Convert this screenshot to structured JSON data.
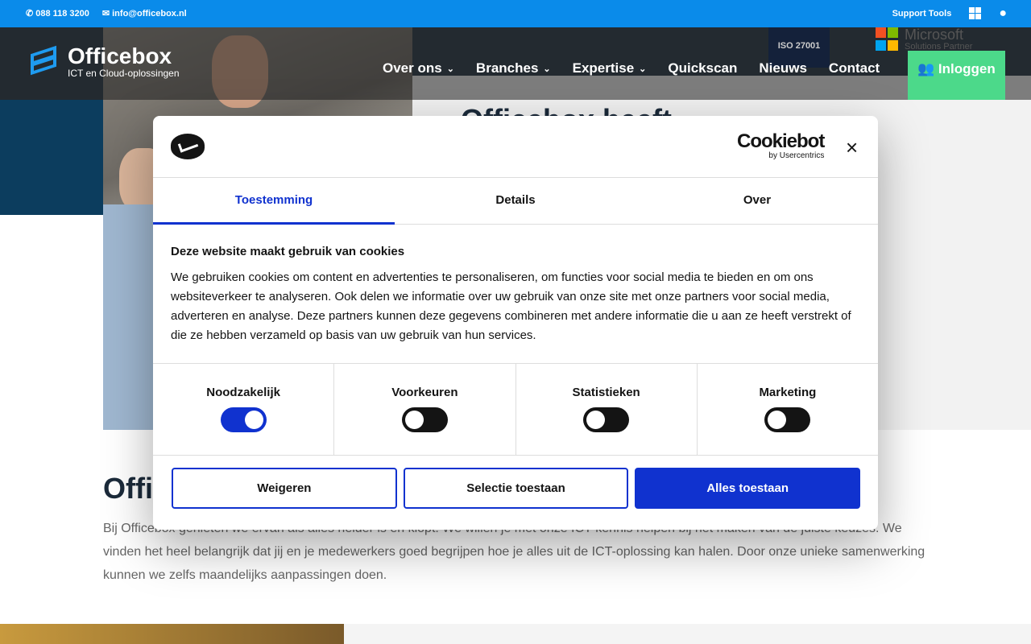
{
  "topbar": {
    "phone": "088 118 3200",
    "email": "info@officebox.nl",
    "support": "Support Tools"
  },
  "header": {
    "logo_name": "Officebox",
    "logo_tagline": "ICT en Cloud-oplossingen",
    "nav": [
      "Over ons",
      "Branches",
      "Expertise",
      "Quickscan",
      "Nieuws",
      "Contact"
    ],
    "login": "Inloggen",
    "iso": "ISO 27001",
    "ms_line1": "Microsoft",
    "ms_line2": "Solutions Partner"
  },
  "hero": {
    "title": "Officebox heeft"
  },
  "section": {
    "title": "Offi",
    "text": "Bij Officebox genieten we ervan als alles helder is en klopt. We willen je met onze ICT-kennis helpen bij het maken van de juiste keuzes. We vinden het heel belangrijk dat jij en je medewerkers goed begrijpen hoe je alles uit de ICT-oplossing kan halen. Door onze unieke samenwerking kunnen we zelfs maandelijks aanpassingen doen."
  },
  "dialog": {
    "brand": "Cookiebot",
    "brand_sub": "by Usercentrics",
    "close": "×",
    "tabs": [
      "Toestemming",
      "Details",
      "Over"
    ],
    "heading": "Deze website maakt gebruik van cookies",
    "body": "We gebruiken cookies om content en advertenties te personaliseren, om functies voor social media te bieden en om ons websiteverkeer te analyseren. Ook delen we informatie over uw gebruik van onze site met onze partners voor social media, adverteren en analyse. Deze partners kunnen deze gegevens combineren met andere informatie die u aan ze heeft verstrekt of die ze hebben verzameld op basis van uw gebruik van hun services.",
    "toggles": [
      {
        "label": "Noodzakelijk",
        "on": true
      },
      {
        "label": "Voorkeuren",
        "on": false
      },
      {
        "label": "Statistieken",
        "on": false
      },
      {
        "label": "Marketing",
        "on": false
      }
    ],
    "buttons": {
      "deny": "Weigeren",
      "selection": "Selectie toestaan",
      "allow_all": "Alles toestaan"
    }
  },
  "colors": {
    "topbar": "#0a8bea",
    "accent": "#1032cf",
    "login": "#4cd98a"
  }
}
